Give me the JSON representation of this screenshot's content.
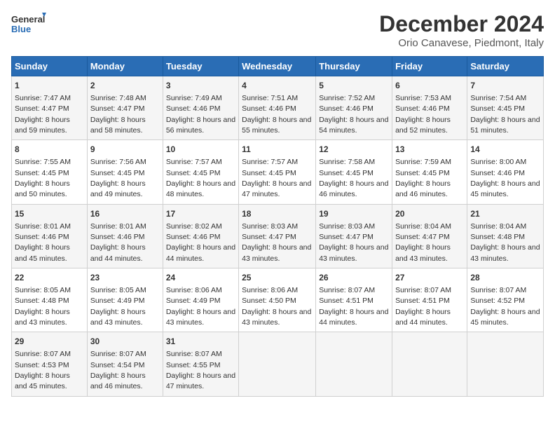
{
  "logo": {
    "line1": "General",
    "line2": "Blue"
  },
  "title": "December 2024",
  "subtitle": "Orio Canavese, Piedmont, Italy",
  "days_of_week": [
    "Sunday",
    "Monday",
    "Tuesday",
    "Wednesday",
    "Thursday",
    "Friday",
    "Saturday"
  ],
  "weeks": [
    [
      {
        "day": "1",
        "rise": "Sunrise: 7:47 AM",
        "set": "Sunset: 4:47 PM",
        "daylight": "Daylight: 8 hours and 59 minutes."
      },
      {
        "day": "2",
        "rise": "Sunrise: 7:48 AM",
        "set": "Sunset: 4:47 PM",
        "daylight": "Daylight: 8 hours and 58 minutes."
      },
      {
        "day": "3",
        "rise": "Sunrise: 7:49 AM",
        "set": "Sunset: 4:46 PM",
        "daylight": "Daylight: 8 hours and 56 minutes."
      },
      {
        "day": "4",
        "rise": "Sunrise: 7:51 AM",
        "set": "Sunset: 4:46 PM",
        "daylight": "Daylight: 8 hours and 55 minutes."
      },
      {
        "day": "5",
        "rise": "Sunrise: 7:52 AM",
        "set": "Sunset: 4:46 PM",
        "daylight": "Daylight: 8 hours and 54 minutes."
      },
      {
        "day": "6",
        "rise": "Sunrise: 7:53 AM",
        "set": "Sunset: 4:46 PM",
        "daylight": "Daylight: 8 hours and 52 minutes."
      },
      {
        "day": "7",
        "rise": "Sunrise: 7:54 AM",
        "set": "Sunset: 4:45 PM",
        "daylight": "Daylight: 8 hours and 51 minutes."
      }
    ],
    [
      {
        "day": "8",
        "rise": "Sunrise: 7:55 AM",
        "set": "Sunset: 4:45 PM",
        "daylight": "Daylight: 8 hours and 50 minutes."
      },
      {
        "day": "9",
        "rise": "Sunrise: 7:56 AM",
        "set": "Sunset: 4:45 PM",
        "daylight": "Daylight: 8 hours and 49 minutes."
      },
      {
        "day": "10",
        "rise": "Sunrise: 7:57 AM",
        "set": "Sunset: 4:45 PM",
        "daylight": "Daylight: 8 hours and 48 minutes."
      },
      {
        "day": "11",
        "rise": "Sunrise: 7:57 AM",
        "set": "Sunset: 4:45 PM",
        "daylight": "Daylight: 8 hours and 47 minutes."
      },
      {
        "day": "12",
        "rise": "Sunrise: 7:58 AM",
        "set": "Sunset: 4:45 PM",
        "daylight": "Daylight: 8 hours and 46 minutes."
      },
      {
        "day": "13",
        "rise": "Sunrise: 7:59 AM",
        "set": "Sunset: 4:45 PM",
        "daylight": "Daylight: 8 hours and 46 minutes."
      },
      {
        "day": "14",
        "rise": "Sunrise: 8:00 AM",
        "set": "Sunset: 4:46 PM",
        "daylight": "Daylight: 8 hours and 45 minutes."
      }
    ],
    [
      {
        "day": "15",
        "rise": "Sunrise: 8:01 AM",
        "set": "Sunset: 4:46 PM",
        "daylight": "Daylight: 8 hours and 45 minutes."
      },
      {
        "day": "16",
        "rise": "Sunrise: 8:01 AM",
        "set": "Sunset: 4:46 PM",
        "daylight": "Daylight: 8 hours and 44 minutes."
      },
      {
        "day": "17",
        "rise": "Sunrise: 8:02 AM",
        "set": "Sunset: 4:46 PM",
        "daylight": "Daylight: 8 hours and 44 minutes."
      },
      {
        "day": "18",
        "rise": "Sunrise: 8:03 AM",
        "set": "Sunset: 4:47 PM",
        "daylight": "Daylight: 8 hours and 43 minutes."
      },
      {
        "day": "19",
        "rise": "Sunrise: 8:03 AM",
        "set": "Sunset: 4:47 PM",
        "daylight": "Daylight: 8 hours and 43 minutes."
      },
      {
        "day": "20",
        "rise": "Sunrise: 8:04 AM",
        "set": "Sunset: 4:47 PM",
        "daylight": "Daylight: 8 hours and 43 minutes."
      },
      {
        "day": "21",
        "rise": "Sunrise: 8:04 AM",
        "set": "Sunset: 4:48 PM",
        "daylight": "Daylight: 8 hours and 43 minutes."
      }
    ],
    [
      {
        "day": "22",
        "rise": "Sunrise: 8:05 AM",
        "set": "Sunset: 4:48 PM",
        "daylight": "Daylight: 8 hours and 43 minutes."
      },
      {
        "day": "23",
        "rise": "Sunrise: 8:05 AM",
        "set": "Sunset: 4:49 PM",
        "daylight": "Daylight: 8 hours and 43 minutes."
      },
      {
        "day": "24",
        "rise": "Sunrise: 8:06 AM",
        "set": "Sunset: 4:49 PM",
        "daylight": "Daylight: 8 hours and 43 minutes."
      },
      {
        "day": "25",
        "rise": "Sunrise: 8:06 AM",
        "set": "Sunset: 4:50 PM",
        "daylight": "Daylight: 8 hours and 43 minutes."
      },
      {
        "day": "26",
        "rise": "Sunrise: 8:07 AM",
        "set": "Sunset: 4:51 PM",
        "daylight": "Daylight: 8 hours and 44 minutes."
      },
      {
        "day": "27",
        "rise": "Sunrise: 8:07 AM",
        "set": "Sunset: 4:51 PM",
        "daylight": "Daylight: 8 hours and 44 minutes."
      },
      {
        "day": "28",
        "rise": "Sunrise: 8:07 AM",
        "set": "Sunset: 4:52 PM",
        "daylight": "Daylight: 8 hours and 45 minutes."
      }
    ],
    [
      {
        "day": "29",
        "rise": "Sunrise: 8:07 AM",
        "set": "Sunset: 4:53 PM",
        "daylight": "Daylight: 8 hours and 45 minutes."
      },
      {
        "day": "30",
        "rise": "Sunrise: 8:07 AM",
        "set": "Sunset: 4:54 PM",
        "daylight": "Daylight: 8 hours and 46 minutes."
      },
      {
        "day": "31",
        "rise": "Sunrise: 8:07 AM",
        "set": "Sunset: 4:55 PM",
        "daylight": "Daylight: 8 hours and 47 minutes."
      },
      null,
      null,
      null,
      null
    ]
  ]
}
